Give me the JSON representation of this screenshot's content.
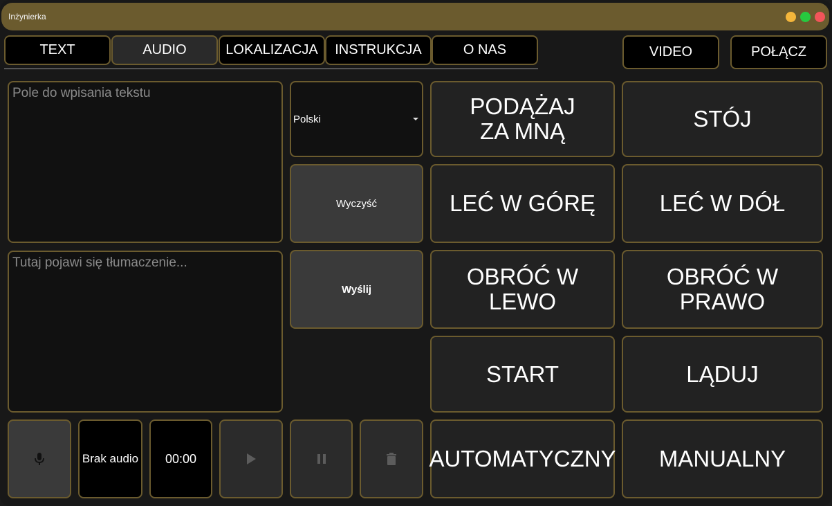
{
  "window": {
    "title": "Inżynierka"
  },
  "tabs": [
    {
      "label": "TEXT"
    },
    {
      "label": "AUDIO"
    },
    {
      "label": "LOKALIZACJA"
    },
    {
      "label": "INSTRUKCJA"
    },
    {
      "label": "O NAS"
    }
  ],
  "top_right": {
    "video_label": "VIDEO",
    "connect_label": "POŁĄCZ"
  },
  "text_input": {
    "placeholder": "Pole do wpisania tekstu",
    "value": ""
  },
  "translation_output": {
    "placeholder": "Tutaj pojawi się tłumaczenie...",
    "value": ""
  },
  "language_select": {
    "selected": "Polski"
  },
  "actions": {
    "clear_label": "Wyczyść",
    "send_label": "Wyślij"
  },
  "audio": {
    "status": "Brak audio",
    "timer": "00:00",
    "icons": [
      "microphone-icon",
      "play-icon",
      "pause-icon",
      "trash-icon"
    ]
  },
  "commands": {
    "follow_line1": "PODĄŻAJ",
    "follow_line2": "ZA MNĄ",
    "stop": "STÓJ",
    "up": "LEĆ W GÓRĘ",
    "down": "LEĆ W DÓŁ",
    "rotate_left": "OBRÓĆ W LEWO",
    "rotate_right": "OBRÓĆ W PRAWO",
    "start": "START",
    "land": "LĄDUJ",
    "auto": "AUTOMATYCZNY",
    "manual": "MANUALNY"
  },
  "colors": {
    "accent": "#6b5b2e",
    "background": "#181818",
    "button": "#222222",
    "button_gray": "#3a3a3a",
    "dot_min": "#f4b63b",
    "dot_max": "#27c93f",
    "dot_close": "#f2555a"
  }
}
